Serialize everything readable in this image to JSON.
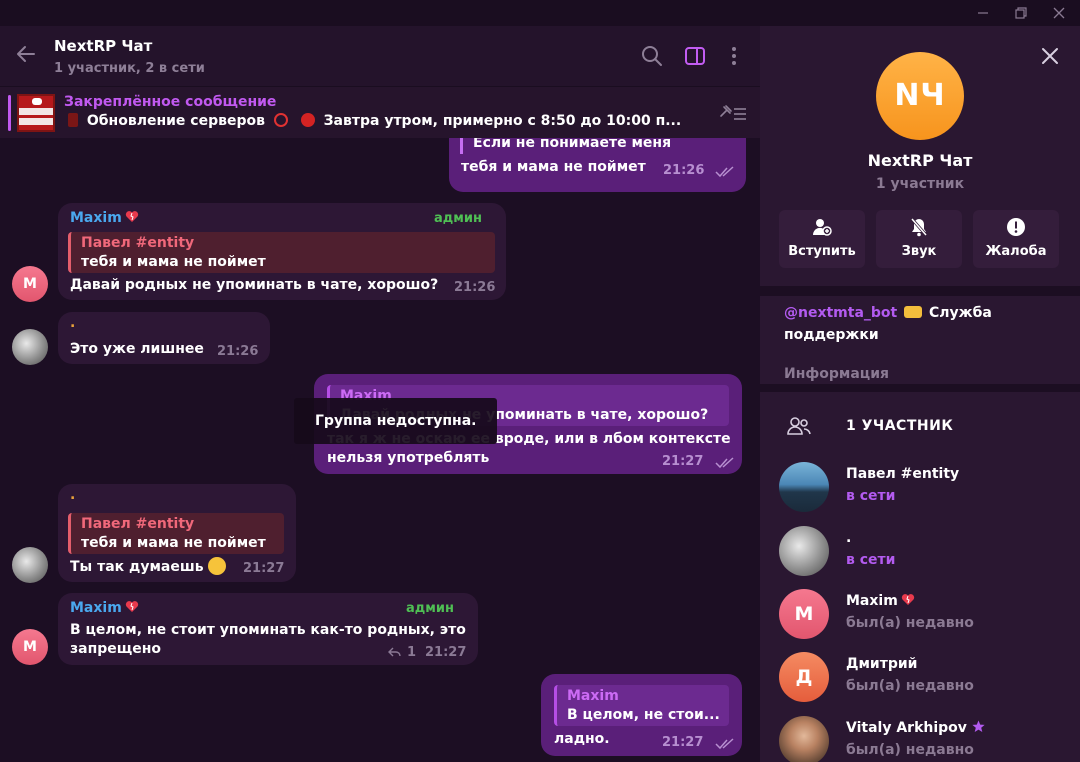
{
  "window": {
    "minimize_icon": "minimize-icon",
    "maximize_icon": "restore-icon",
    "close_icon": "close-icon"
  },
  "header": {
    "title": "NextRP Чат",
    "subtitle": "1 участник, 2 в сети"
  },
  "pinned": {
    "title": "Закреплённое сообщение",
    "text_part1": "Обновление серверов",
    "text_part2": "Завтра утром, примерно с 8:50 до 10:00 п...",
    "thumb_text": "ОБНОВЛЕНИЕ СЕРВЕРОВ"
  },
  "messages": {
    "m1": {
      "line1": "Если не понимаете меня",
      "line2": "тебя и мама не поймет",
      "time": "21:26"
    },
    "m2": {
      "sender": "Maxim",
      "badge": "админ",
      "reply_name": "Павел #entity",
      "reply_text": "тебя и мама не поймет",
      "text": "Давай родных не упоминать в чате, хорошо?",
      "time": "21:26",
      "avatar": "M"
    },
    "m3": {
      "sender": ".",
      "text": "Это уже лишнее",
      "time": "21:26"
    },
    "m4": {
      "reply_name": "Maxim",
      "reply_text": "Давай родных не упоминать в чате, хорошо?",
      "line1": "так я ж не оскаю ее вроде, или в лбом контексте",
      "line2": "нельзя употреблять",
      "time": "21:27"
    },
    "m5": {
      "sender": ".",
      "reply_name": "Павел #entity",
      "reply_text": "тебя и мама не поймет",
      "text": "Ты так думаешь",
      "time": "21:27"
    },
    "m6": {
      "sender": "Maxim",
      "badge": "админ",
      "line1": "В целом, не стоит упоминать как-то родных, это",
      "line2": "запрещено",
      "replies": "1",
      "time": "21:27",
      "avatar": "M"
    },
    "m7": {
      "reply_name": "Maxim",
      "reply_text": "В целом, не стои...",
      "text": "ладно.",
      "time": "21:27"
    }
  },
  "toast": {
    "text": "Группа недоступна."
  },
  "panel": {
    "avatar_text": "NЧ",
    "name": "NextRP Чат",
    "subtitle": "1 участник",
    "btn_join": "Вступить",
    "btn_sound": "Звук",
    "btn_report": "Жалоба",
    "desc_link": "@nextmta_bot",
    "desc_text1": "Служба",
    "desc_text2": "поддержки",
    "desc_info": "Информация",
    "members_title": "1 УЧАСТНИК",
    "members": [
      {
        "name": "Павел #entity",
        "status": "в сети",
        "avatar": ""
      },
      {
        "name": ".",
        "status": "в сети",
        "avatar": ""
      },
      {
        "name": "Maxim",
        "status": "был(а) недавно",
        "avatar": "M"
      },
      {
        "name": "Дмитрий",
        "status": "был(а) недавно",
        "avatar": "Д"
      },
      {
        "name": "Vitaly Arkhipov",
        "status": "был(а) недавно",
        "avatar": ""
      }
    ]
  },
  "colors": {
    "accent": "#b35bf0",
    "admin": "#4fbf54",
    "sender_blue": "#4aa8ee",
    "sender_orange": "#e9a23b",
    "outgoing_bubble": "#5a1f79",
    "incoming_bubble": "#2d1735"
  }
}
